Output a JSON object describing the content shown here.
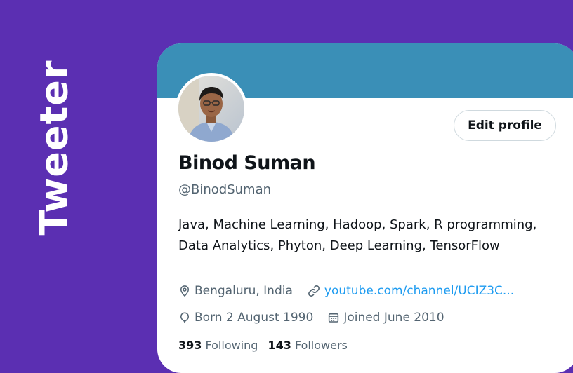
{
  "side_title": "Tweeter",
  "colors": {
    "page_background": "#5b2fb2",
    "banner": "#3a8fb7",
    "link": "#1d9bf0",
    "secondary_text": "#536471"
  },
  "profile": {
    "avatar_icon": "user-avatar-photo",
    "edit_button_label": "Edit profile",
    "display_name": "Binod Suman",
    "handle": "@BinodSuman",
    "bio": "Java, Machine Learning, Hadoop, Spark, R programming, Data Analytics, Phyton, Deep Learning, TensorFlow",
    "location": {
      "icon": "location-pin-icon",
      "text": "Bengaluru, India"
    },
    "website": {
      "icon": "link-icon",
      "text": "youtube.com/channel/UCIZ3C..."
    },
    "birthday": {
      "icon": "balloon-icon",
      "text": "Born 2 August 1990"
    },
    "joined": {
      "icon": "calendar-icon",
      "text": "Joined June 2010"
    },
    "following": {
      "count": "393",
      "label": "Following"
    },
    "followers": {
      "count": "143",
      "label": "Followers"
    }
  }
}
